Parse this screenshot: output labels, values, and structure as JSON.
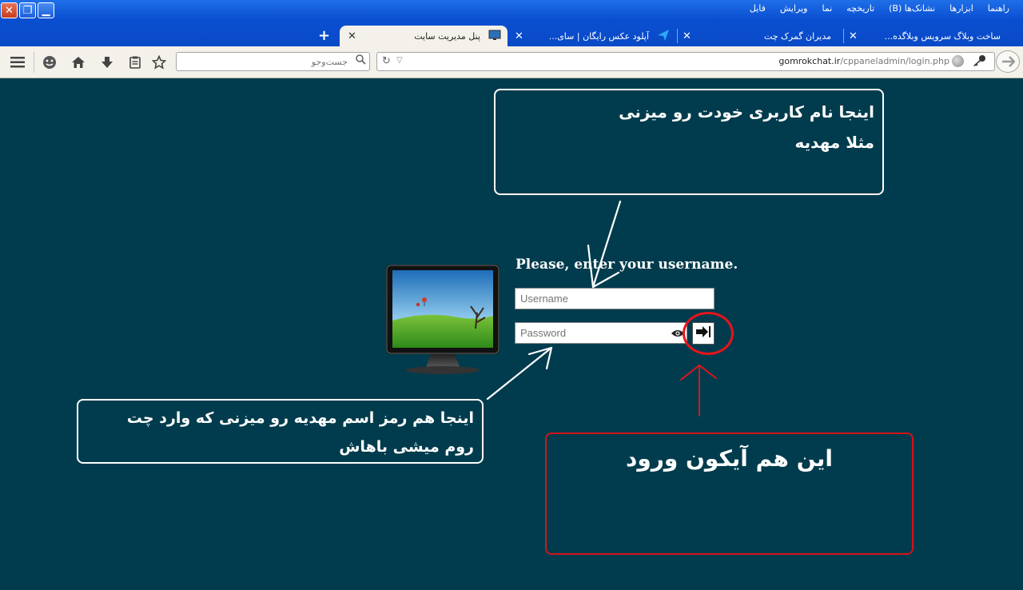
{
  "window": {
    "close_symbol": "✕",
    "restore_symbol": "❐",
    "minimize_symbol": "▁"
  },
  "menu": {
    "items": [
      "فایل",
      "ویرایش",
      "نما",
      "تاریخچه",
      "نشانک‌ها (B)",
      "ابزارها",
      "راهنما"
    ]
  },
  "tabs": [
    {
      "title": "ساخت وبلاگ سرویس وبلاگده...",
      "active": false
    },
    {
      "title": "مدیران گمرک چت",
      "active": false
    },
    {
      "title": "آپلود عکس رایگان | سای...",
      "active": false
    },
    {
      "title": "پنل مدیریت سایت",
      "active": true
    }
  ],
  "tab_close_symbol": "✕",
  "new_tab_symbol": "+",
  "toolbar": {
    "search_placeholder": "جست‌وجو",
    "url_host": "gomrokchat.ir",
    "url_path": "/cppaneladmin/login.php"
  },
  "login": {
    "title": "Please, enter your username.",
    "username_placeholder": "Username",
    "password_placeholder": "Password"
  },
  "annotations": {
    "username_line1": "اینجا نام کاربری خودت رو میزنی",
    "username_line2": "مثلا مهدیه",
    "password_line1": "اینجا هم رمز اسم مهدیه رو میزنی که وارد چت",
    "password_line2": "روم میشی باهاش",
    "login_text": "این هم آیکون ورود"
  },
  "colors": {
    "page_background": "#003c4d",
    "titlebar": "#0a4fd1",
    "annotation_red": "#e8141a",
    "toolbar_background": "#f3f1ea"
  }
}
